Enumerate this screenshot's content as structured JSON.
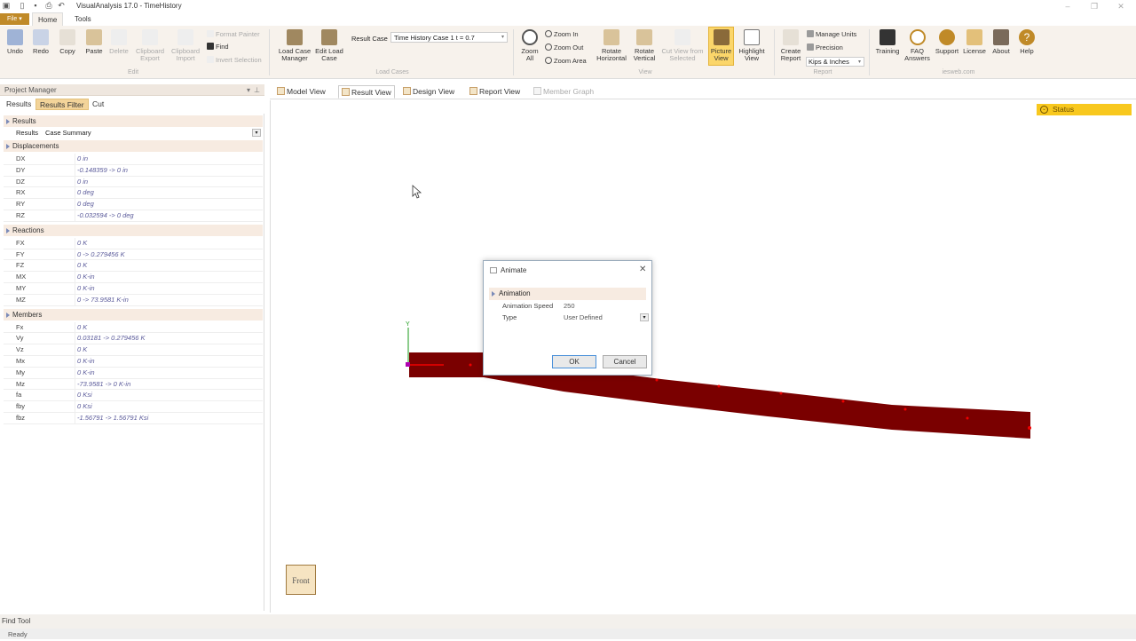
{
  "window": {
    "title": "VisualAnalysis 17.0 - TimeHistory"
  },
  "ribbon_tabs": {
    "file": "File ▾",
    "home": "Home",
    "tools": "Tools"
  },
  "ribbon": {
    "undo": "Undo",
    "redo": "Redo",
    "copy": "Copy",
    "paste": "Paste",
    "delete": "Delete",
    "clipboard_export": "Clipboard Export",
    "clipboard_import": "Clipboard Import",
    "format_painter": "Format Painter",
    "find": "Find",
    "invert_selection": "Invert Selection",
    "group_edit": "Edit",
    "load_case_manager": "Load Case Manager",
    "edit_load_case": "Edit Load Case",
    "result_case_label": "Result Case",
    "result_case_value": "Time History Case 1 t = 0.7",
    "group_load_cases": "Load Cases",
    "zoom_all": "Zoom All",
    "zoom_in": "Zoom In",
    "zoom_out": "Zoom Out",
    "zoom_area": "Zoom Area",
    "rotate_horizontal": "Rotate Horizontal",
    "rotate_vertical": "Rotate Vertical",
    "cut_view": "Cut View from Selected",
    "picture_view": "Picture View",
    "highlight_view": "Highlight View",
    "group_view": "View",
    "create_report": "Create Report",
    "manage_units": "Manage Units",
    "precision": "Precision",
    "units_value": "Kips & Inches",
    "group_report": "Report",
    "training": "Training",
    "faq": "FAQ Answers",
    "support": "Support",
    "license": "License",
    "about": "About",
    "help": "Help",
    "group_iesweb": "iesweb.com"
  },
  "project_manager": {
    "title": "Project Manager",
    "tabs": [
      "Results",
      "Results Filter",
      "Cut"
    ],
    "results_section": "Results",
    "results_label": "Results",
    "results_value": "Case Summary",
    "sections": [
      {
        "name": "Displacements",
        "rows": [
          {
            "k": "DX",
            "v": "0 in"
          },
          {
            "k": "DY",
            "v": "-0.148359 -> 0 in"
          },
          {
            "k": "DZ",
            "v": "0 in"
          },
          {
            "k": "RX",
            "v": "0 deg"
          },
          {
            "k": "RY",
            "v": "0 deg"
          },
          {
            "k": "RZ",
            "v": "-0.032594 -> 0 deg"
          }
        ]
      },
      {
        "name": "Reactions",
        "rows": [
          {
            "k": "FX",
            "v": "0 K"
          },
          {
            "k": "FY",
            "v": "0 -> 0.279456 K"
          },
          {
            "k": "FZ",
            "v": "0 K"
          },
          {
            "k": "MX",
            "v": "0 K-in"
          },
          {
            "k": "MY",
            "v": "0 K-in"
          },
          {
            "k": "MZ",
            "v": "0 -> 73.9581 K-in"
          }
        ]
      },
      {
        "name": "Members",
        "rows": [
          {
            "k": "Fx",
            "v": "0 K"
          },
          {
            "k": "Vy",
            "v": "0.03181 -> 0.279456 K"
          },
          {
            "k": "Vz",
            "v": "0 K"
          },
          {
            "k": "Mx",
            "v": "0 K-in"
          },
          {
            "k": "My",
            "v": "0 K-in"
          },
          {
            "k": "Mz",
            "v": "-73.9581 -> 0 K-in"
          },
          {
            "k": "fa",
            "v": "0 Ksi"
          },
          {
            "k": "fby",
            "v": "0 Ksi"
          },
          {
            "k": "fbz",
            "v": "-1.56791 -> 1.56791 Ksi"
          }
        ]
      }
    ]
  },
  "view_tabs": [
    "Model View",
    "Result View",
    "Design View",
    "Report View",
    "Member Graph"
  ],
  "viewport": {
    "status": "Status",
    "front": "Front",
    "axis_y": "Y"
  },
  "dialog": {
    "title": "Animate",
    "section": "Animation",
    "speed_label": "Animation Speed",
    "speed_value": "250",
    "type_label": "Type",
    "type_value": "User Defined",
    "ok": "OK",
    "cancel": "Cancel"
  },
  "footer": {
    "find_tool": "Find Tool",
    "status": "Ready"
  },
  "colors": {
    "beam": "#7a0000",
    "accent": "#f8c81e",
    "file_tab": "#c08a28"
  }
}
